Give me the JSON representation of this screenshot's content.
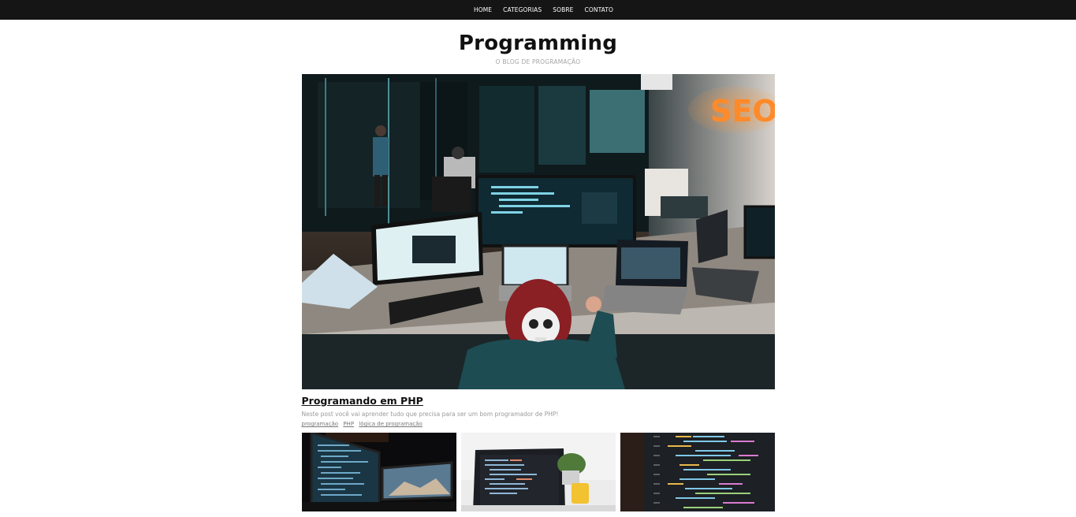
{
  "nav": {
    "items": [
      {
        "label": "HOME"
      },
      {
        "label": "CATEGORIAS"
      },
      {
        "label": "SOBRE"
      },
      {
        "label": "CONTATO"
      }
    ]
  },
  "header": {
    "title": "Programming",
    "tagline": "O BLOG DE PROGRAMAÇÃO"
  },
  "featured": {
    "image_alt": "programmer-desk-photo",
    "sign_text": "SEO",
    "title": "Programando em PHP",
    "excerpt": "Neste post você vai aprender tudo que precisa para ser um bom programador de PHP!",
    "tags": [
      "programação",
      "PHP",
      "lógica de programação"
    ]
  },
  "grid": {
    "cards": [
      {
        "image_alt": "dual-monitor-code-photo"
      },
      {
        "image_alt": "laptop-code-photo"
      },
      {
        "image_alt": "code-closeup-photo"
      }
    ]
  },
  "colors": {
    "nav_bg": "#151515",
    "title": "#111111",
    "muted": "#a5a5a5"
  }
}
